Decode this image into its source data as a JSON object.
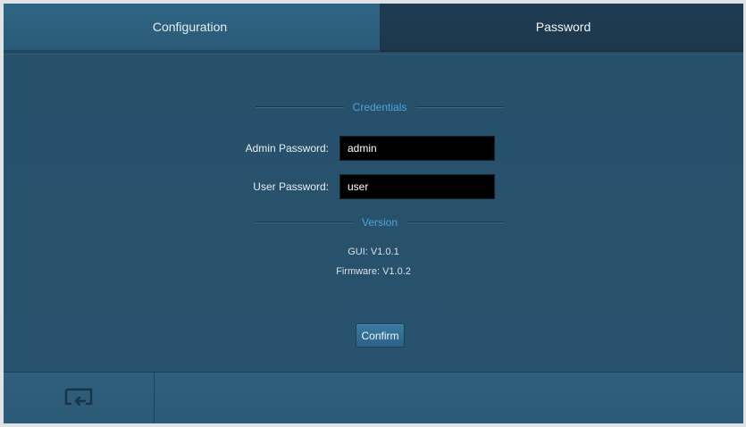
{
  "tabs": {
    "configuration": "Configuration",
    "password": "Password"
  },
  "credentials": {
    "title": "Credentials",
    "admin_label": "Admin Password:",
    "admin_value": "admin",
    "user_label": "User Password:",
    "user_value": "user"
  },
  "version": {
    "title": "Version",
    "gui": "GUI: V1.0.1",
    "firmware": "Firmware: V1.0.2"
  },
  "actions": {
    "confirm": "Confirm"
  },
  "bottom_bar": {
    "icon": "return-icon"
  },
  "colors": {
    "background": "#264a63",
    "accent": "#4fa3d8",
    "active_tab": "#1f3c52"
  }
}
